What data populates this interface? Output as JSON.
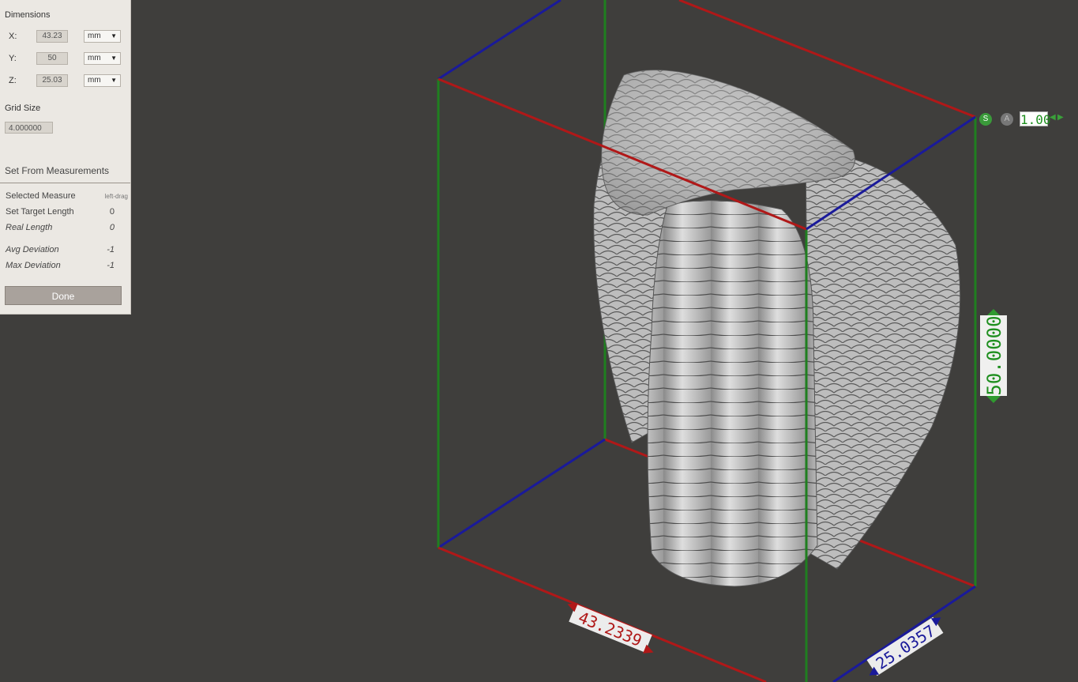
{
  "panel": {
    "dimensions_title": "Dimensions",
    "x": {
      "axis": "X:",
      "value": "43.23",
      "unit": "mm"
    },
    "y": {
      "axis": "Y:",
      "value": "50",
      "unit": "mm"
    },
    "z": {
      "axis": "Z:",
      "value": "25.03",
      "unit": "mm"
    },
    "grid_title": "Grid Size",
    "grid_value": "4.000000",
    "measure_title": "Set From Measurements",
    "selected_measure": {
      "label": "Selected Measure",
      "value": "left-drag"
    },
    "target_length": {
      "label": "Set Target Length",
      "value": "0"
    },
    "real_length": {
      "label": "Real Length",
      "value": "0"
    },
    "avg_deviation": {
      "label": "Avg Deviation",
      "value": "-1"
    },
    "max_deviation": {
      "label": "Max Deviation",
      "value": "-1"
    },
    "done_label": "Done"
  },
  "scale_control": {
    "s_label": "S",
    "a_label": "A",
    "value": "1.00"
  },
  "viewport_labels": {
    "height_value": "50.0000",
    "width_value": "43.2339",
    "depth_value": "25.0357"
  },
  "colors": {
    "x_axis": "#b01818",
    "y_axis": "#1f7f1f",
    "z_axis": "#1a1a9a",
    "viewport_bg": "#3f3e3c",
    "panel_bg": "#ebe8e3"
  }
}
